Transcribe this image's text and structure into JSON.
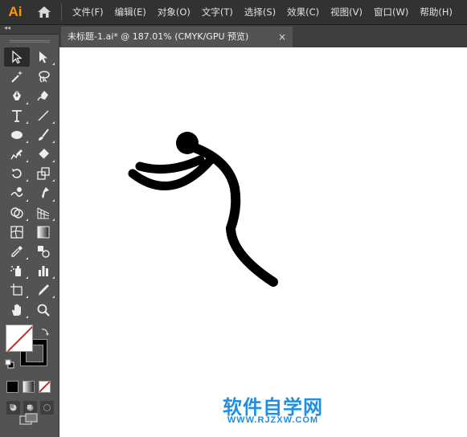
{
  "app": {
    "logo": "Ai",
    "accent": "#ff9a00"
  },
  "menu": {
    "items": [
      "文件(F)",
      "编辑(E)",
      "对象(O)",
      "文字(T)",
      "选择(S)",
      "效果(C)",
      "视图(V)",
      "窗口(W)",
      "帮助(H)"
    ]
  },
  "toolbar": {
    "collapse_glyph": "◂◂",
    "tools": [
      "selection-tool",
      "direct-selection-tool",
      "magic-wand-tool",
      "lasso-tool",
      "pen-tool",
      "curvature-tool",
      "type-tool",
      "line-segment-tool",
      "ellipse-tool",
      "paintbrush-tool",
      "shaper-tool",
      "eraser-tool",
      "rotate-tool",
      "scale-tool",
      "warp-tool",
      "puppet-warp-tool",
      "shape-builder-tool",
      "perspective-grid-tool",
      "mesh-tool",
      "gradient-tool",
      "eyedropper-tool",
      "blend-tool",
      "symbol-sprayer-tool",
      "column-graph-tool",
      "artboard-tool",
      "slice-tool",
      "hand-tool",
      "zoom-tool"
    ],
    "active_tool": "selection-tool",
    "fill": "none",
    "stroke": "#000000"
  },
  "document": {
    "tab_title": "未标题-1.ai* @ 187.01% (CMYK/GPU 预览)",
    "close_glyph": "×"
  },
  "watermark": {
    "cn": "软件自学网",
    "url": "WWW.RJZXW.COM",
    "color": "#1e8fe6"
  }
}
